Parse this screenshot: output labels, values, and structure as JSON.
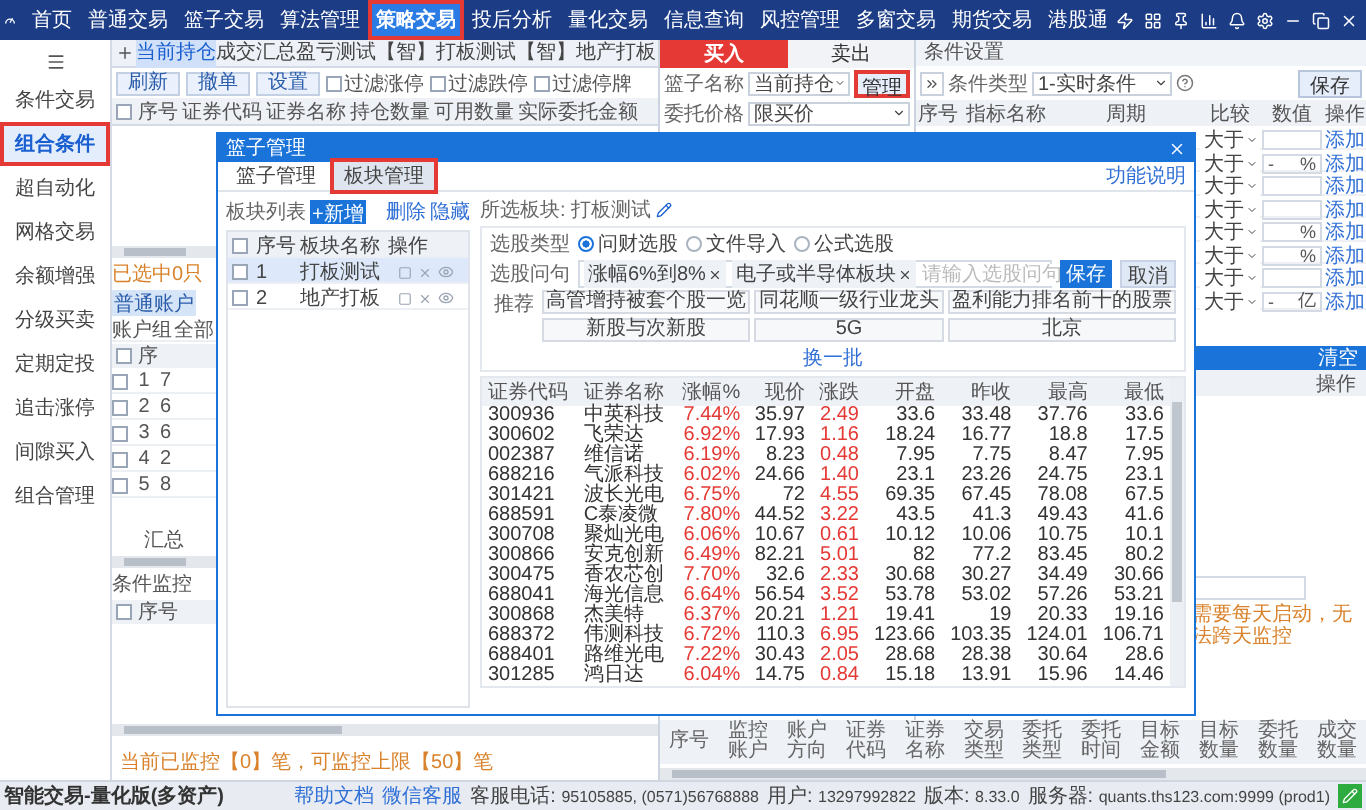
{
  "nav": {
    "items": [
      {
        "label": "首页",
        "selected": false,
        "highlighted": false
      },
      {
        "label": "普通交易",
        "selected": false,
        "highlighted": false
      },
      {
        "label": "篮子交易",
        "selected": false,
        "highlighted": false
      },
      {
        "label": "算法管理",
        "selected": false,
        "highlighted": false
      },
      {
        "label": "策略交易",
        "selected": true,
        "highlighted": true
      },
      {
        "label": "投后分析",
        "selected": false,
        "highlighted": false
      },
      {
        "label": "量化交易",
        "selected": false,
        "highlighted": false
      },
      {
        "label": "信息查询",
        "selected": false,
        "highlighted": false
      },
      {
        "label": "风控管理",
        "selected": false,
        "highlighted": false
      },
      {
        "label": "多窗交易",
        "selected": false,
        "highlighted": false
      },
      {
        "label": "期货交易",
        "selected": false,
        "highlighted": false
      },
      {
        "label": "港股通",
        "selected": false,
        "highlighted": false
      }
    ]
  },
  "sidebar": {
    "items": [
      {
        "label": "条件交易",
        "selected": false,
        "highlighted": false
      },
      {
        "label": "组合条件",
        "selected": true,
        "highlighted": true
      },
      {
        "label": "超自动化",
        "selected": false,
        "highlighted": false
      },
      {
        "label": "网格交易",
        "selected": false,
        "highlighted": false
      },
      {
        "label": "余额增强",
        "selected": false,
        "highlighted": false
      },
      {
        "label": "分级买卖",
        "selected": false,
        "highlighted": false
      },
      {
        "label": "定期定投",
        "selected": false,
        "highlighted": false
      },
      {
        "label": "追击涨停",
        "selected": false,
        "highlighted": false
      },
      {
        "label": "间隙买入",
        "selected": false,
        "highlighted": false
      },
      {
        "label": "组合管理",
        "selected": false,
        "highlighted": false
      }
    ]
  },
  "holdings": {
    "tabs": [
      {
        "label": "当前持仓",
        "selected": true
      },
      {
        "label": "成交汇总",
        "selected": false
      },
      {
        "label": "盈亏测试",
        "selected": false
      },
      {
        "label": "【智】打板测试",
        "selected": false
      },
      {
        "label": "【智】地产打板",
        "selected": false
      }
    ],
    "buttons": [
      "刷新",
      "撤单",
      "设置"
    ],
    "filters": [
      {
        "label": "过滤涨停",
        "checked": false
      },
      {
        "label": "过滤跌停",
        "checked": false
      },
      {
        "label": "过滤停牌",
        "checked": false
      }
    ],
    "select_all_checked": false,
    "columns": [
      "序号",
      "证券代码",
      "证券名称",
      "持仓数量",
      "可用数量",
      "实际委托金额"
    ],
    "selection_note": "已选中0只",
    "account_tab": "普通账户",
    "account_group": {
      "label": "账户组",
      "value": "全部"
    },
    "account_select_all_checked": false,
    "account_columns": [
      "序"
    ],
    "account_rows": [
      {
        "index": "1",
        "column_2": "7",
        "checked": false
      },
      {
        "index": "2",
        "column_2": "6",
        "checked": false
      },
      {
        "index": "3",
        "column_2": "6",
        "checked": false
      },
      {
        "index": "4",
        "column_2": "2",
        "checked": false
      },
      {
        "index": "5",
        "column_2": "8",
        "checked": false
      }
    ],
    "summary": "汇总",
    "monitor": {
      "title": "条件监控",
      "select_all_checked": false,
      "columns": [
        "序号"
      ]
    },
    "monitor_note": "当前已监控【0】笔，可监控上限【50】笔"
  },
  "order": {
    "sides": [
      {
        "label": "买入",
        "selected": true
      },
      {
        "label": "卖出",
        "selected": false
      }
    ],
    "basket": {
      "label": "篮子名称",
      "value": "当前持仓"
    },
    "manage_button": {
      "label": "管理",
      "highlighted": true
    },
    "price": {
      "label": "委托价格",
      "value": "限买价"
    }
  },
  "conditions": {
    "title": "条件设置",
    "type": {
      "label": "条件类型",
      "value": "1-实时条件"
    },
    "save": "保存",
    "columns": [
      "序号",
      "指标名称",
      "周期",
      "比较",
      "数值",
      "操作"
    ],
    "rows": [
      {
        "compare": "大于",
        "action": "添加"
      },
      {
        "compare": "大于",
        "prefix": "-",
        "unit": "%",
        "action": "添加"
      },
      {
        "compare": "大于",
        "action": "添加"
      },
      {
        "compare": "大于",
        "action": "添加"
      },
      {
        "compare": "大于",
        "unit": "%",
        "action": "添加"
      },
      {
        "compare": "大于",
        "unit": "%",
        "action": "添加"
      },
      {
        "compare": "大于",
        "action": "添加"
      },
      {
        "compare": "大于",
        "prefix": "-",
        "unit": "亿",
        "action": "添加"
      }
    ]
  },
  "tasks": {
    "clear": "清空",
    "columns": [
      "操作"
    ],
    "note": "需要每天启动，无法跨天监控"
  },
  "orders_table": {
    "columns": [
      "序号",
      "监控账户",
      "账户方向",
      "证券代码",
      "证券名称",
      "交易类型",
      "委托类型",
      "委托时间",
      "目标金额",
      "目标数量",
      "委托数量",
      "成交数量"
    ]
  },
  "dialog": {
    "title": "篮子管理",
    "tabs": [
      {
        "label": "篮子管理",
        "selected": false,
        "highlighted": false
      },
      {
        "label": "板块管理",
        "selected": true,
        "highlighted": true
      }
    ],
    "help_link": "功能说明",
    "list": {
      "label": "板块列表",
      "add": "+新增",
      "actions": [
        "删除",
        "隐藏"
      ],
      "select_all_checked": false,
      "columns": [
        "序号",
        "板块名称",
        "操作"
      ],
      "rows": [
        {
          "index": "1",
          "name": "打板测试",
          "selected": true,
          "checked": false
        },
        {
          "index": "2",
          "name": "地产打板",
          "selected": false,
          "checked": false
        }
      ]
    },
    "selected_label": "所选板块: 打板测试",
    "pick_type": {
      "label": "选股类型",
      "options": [
        {
          "label": "问财选股",
          "selected": true
        },
        {
          "label": "文件导入",
          "selected": false
        },
        {
          "label": "公式选股",
          "selected": false
        }
      ]
    },
    "query": {
      "label": "选股问句",
      "tags": [
        "涨幅6%到8%",
        "电子或半导体板块"
      ],
      "placeholder": "请输入选股问句",
      "save": "保存",
      "cancel": "取消"
    },
    "recommend": {
      "label": "推荐",
      "items": [
        "高管增持被套个股一览",
        "同花顺一级行业龙头",
        "盈利能力排名前十的股票",
        "新股与次新股",
        "5G",
        "北京"
      ],
      "more": "换一批"
    },
    "table": {
      "columns": [
        "证券代码",
        "证券名称",
        "涨幅%",
        "现价",
        "涨跌",
        "开盘",
        "昨收",
        "最高",
        "最低"
      ],
      "rows": [
        [
          "300936",
          "中英科技",
          "7.44%",
          "35.97",
          "2.49",
          "33.6",
          "33.48",
          "37.76",
          "33.6"
        ],
        [
          "300602",
          "飞荣达",
          "6.92%",
          "17.93",
          "1.16",
          "18.24",
          "16.77",
          "18.8",
          "17.5"
        ],
        [
          "002387",
          "维信诺",
          "6.19%",
          "8.23",
          "0.48",
          "7.95",
          "7.75",
          "8.47",
          "7.95"
        ],
        [
          "688216",
          "气派科技",
          "6.02%",
          "24.66",
          "1.40",
          "23.1",
          "23.26",
          "24.75",
          "23.1"
        ],
        [
          "301421",
          "波长光电",
          "6.75%",
          "72",
          "4.55",
          "69.35",
          "67.45",
          "78.08",
          "67.5"
        ],
        [
          "688591",
          "C泰凌微",
          "7.80%",
          "44.52",
          "3.22",
          "43.5",
          "41.3",
          "49.43",
          "41.6"
        ],
        [
          "300708",
          "聚灿光电",
          "6.06%",
          "10.67",
          "0.61",
          "10.12",
          "10.06",
          "10.75",
          "10.1"
        ],
        [
          "300866",
          "安克创新",
          "6.49%",
          "82.21",
          "5.01",
          "82",
          "77.2",
          "83.45",
          "80.2"
        ],
        [
          "300475",
          "香农芯创",
          "7.70%",
          "32.6",
          "2.33",
          "30.68",
          "30.27",
          "34.49",
          "30.66"
        ],
        [
          "688041",
          "海光信息",
          "6.64%",
          "56.54",
          "3.52",
          "53.78",
          "53.02",
          "57.26",
          "53.21"
        ],
        [
          "300868",
          "杰美特",
          "6.37%",
          "20.21",
          "1.21",
          "19.41",
          "19",
          "20.33",
          "19.16"
        ],
        [
          "688372",
          "伟测科技",
          "6.72%",
          "110.3",
          "6.95",
          "123.66",
          "103.35",
          "124.01",
          "106.71"
        ],
        [
          "688401",
          "路维光电",
          "7.22%",
          "30.43",
          "2.05",
          "28.68",
          "28.38",
          "30.64",
          "28.6"
        ],
        [
          "301285",
          "鸿日达",
          "6.04%",
          "14.75",
          "0.84",
          "15.18",
          "13.91",
          "15.96",
          "14.46"
        ]
      ]
    }
  },
  "status_bar": {
    "app_name": "智能交易-量化版(多资产)",
    "links": [
      "帮助文档",
      "微信客服"
    ],
    "items": [
      {
        "label": "客服电话:",
        "value": "95105885, (0571)56768888"
      },
      {
        "label": "用户:",
        "value": "13297992822"
      },
      {
        "label": "版本:",
        "value": "8.33.0"
      },
      {
        "label": "服务器:",
        "value": "quants.ths123.com:9999 (prod1)"
      }
    ]
  }
}
